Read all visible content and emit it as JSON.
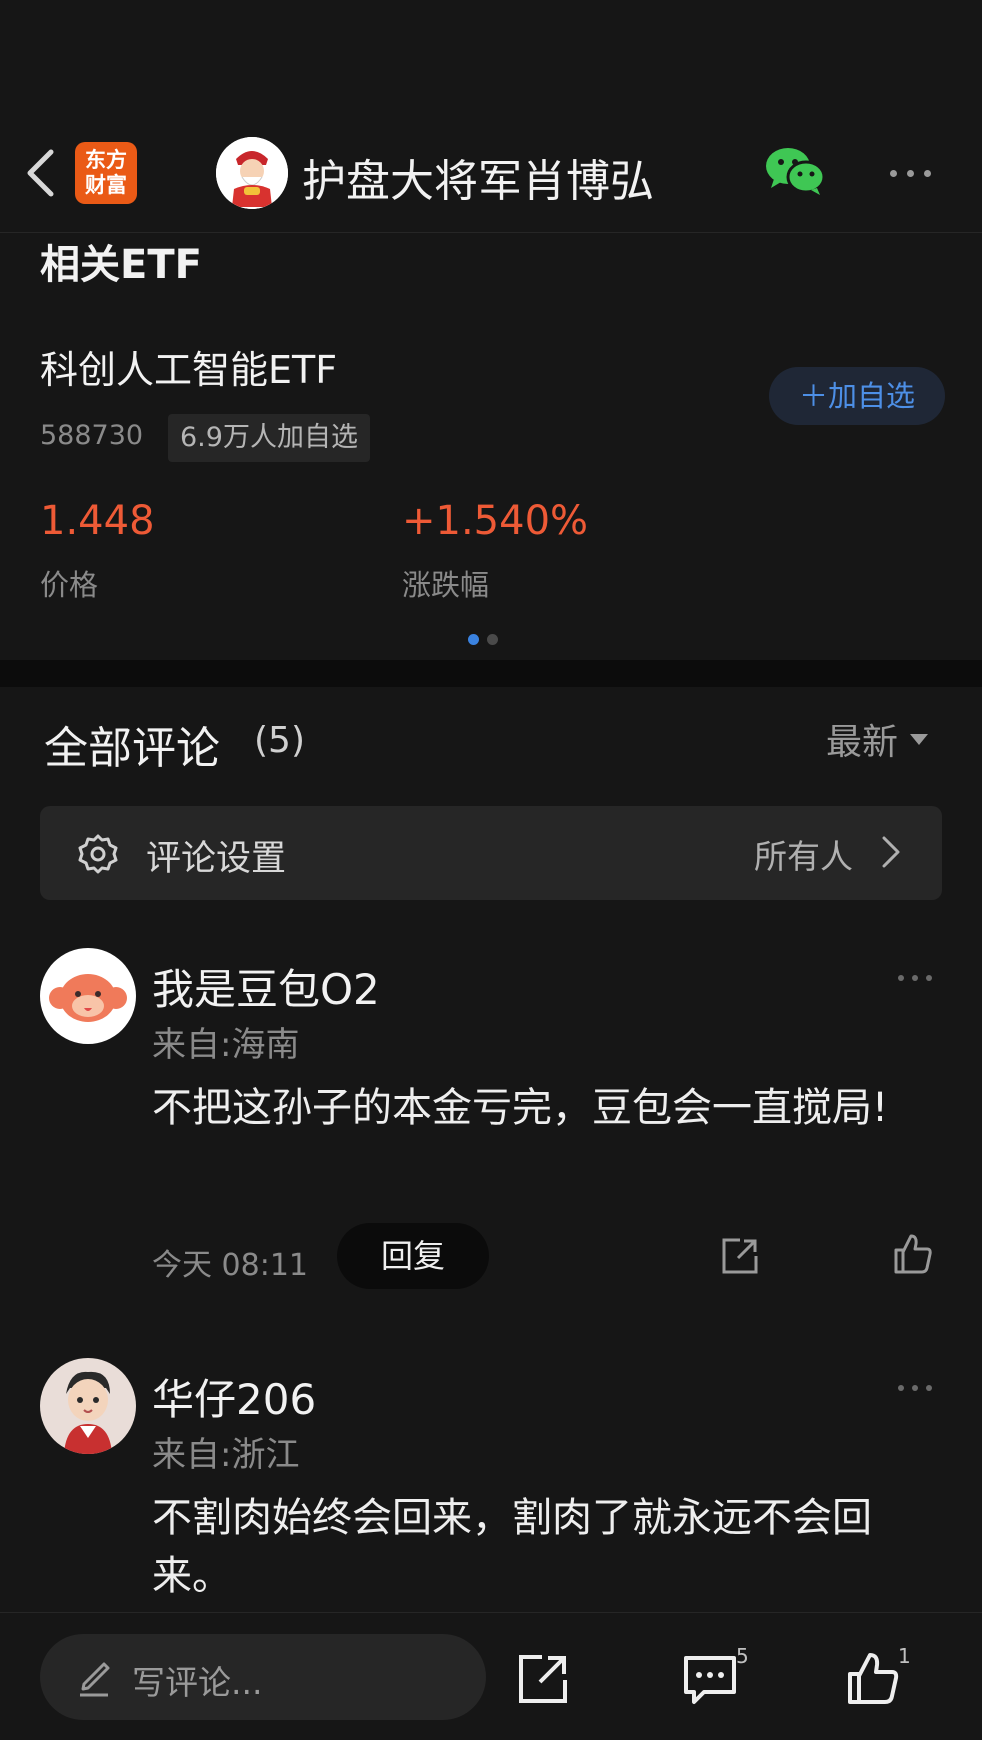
{
  "header": {
    "logo_line1": "东方",
    "logo_line2": "财富",
    "title": "护盘大将军肖博弘"
  },
  "etf": {
    "heading": "相关ETF",
    "name": "科创人工智能ETF",
    "code": "588730",
    "watchers": "6.9万人加自选",
    "add_button": "＋加自选",
    "price_value": "1.448",
    "price_label": "价格",
    "change_value": "+1.540%",
    "change_label": "涨跌幅"
  },
  "comments": {
    "title": "全部评论",
    "count": "(5)",
    "sort_label": "最新",
    "settings_label": "评论设置",
    "settings_value": "所有人",
    "items": [
      {
        "username": "我是豆包O2",
        "location": "来自:海南",
        "content": "不把这孙子的本金亏完，豆包会一直搅局!",
        "time": "今天 08:11",
        "reply": "回复"
      },
      {
        "username": "华仔206",
        "location": "来自:浙江",
        "content": "不割肉始终会回来，割肉了就永远不会回来。"
      }
    ]
  },
  "bottom_bar": {
    "input_placeholder": "写评论...",
    "comment_count": "5",
    "like_count": "1"
  },
  "colors": {
    "background": "#161616",
    "accent_red": "#ee5a36",
    "accent_blue": "#4d8fe6",
    "logo_orange": "#ea5a16",
    "wechat_green": "#3fc754"
  }
}
